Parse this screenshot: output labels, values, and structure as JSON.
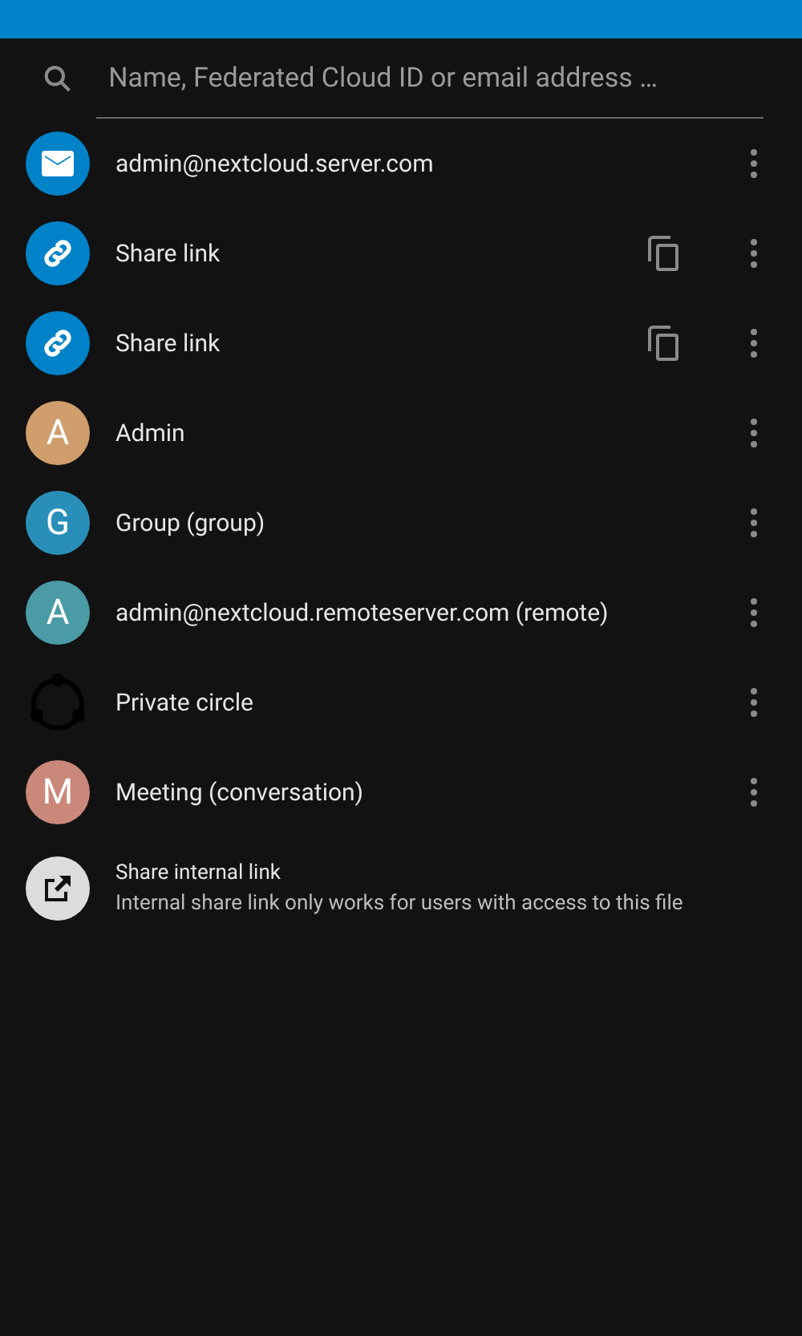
{
  "search": {
    "placeholder": "Name, Federated Cloud ID or email address …"
  },
  "shares": [
    {
      "kind": "email",
      "label": "admin@nextcloud.server.com",
      "copy": false
    },
    {
      "kind": "link",
      "label": "Share link",
      "copy": true
    },
    {
      "kind": "link",
      "label": "Share link",
      "copy": true
    },
    {
      "kind": "letter",
      "initial": "A",
      "color": "#d09e6d",
      "label": "Admin",
      "copy": false
    },
    {
      "kind": "letter",
      "initial": "G",
      "color": "#2a8fb8",
      "label": "Group (group)",
      "copy": false
    },
    {
      "kind": "letter",
      "initial": "A",
      "color": "#4a9ba5",
      "label": "admin@nextcloud.remoteserver.com (remote)",
      "copy": false
    },
    {
      "kind": "circle",
      "label": "Private circle",
      "copy": false
    },
    {
      "kind": "letter",
      "initial": "M",
      "color": "#c98879",
      "label": "Meeting (conversation)",
      "copy": false
    }
  ],
  "internal_link": {
    "title": "Share internal link",
    "subtitle": "Internal share link only works for users with access to this file"
  }
}
